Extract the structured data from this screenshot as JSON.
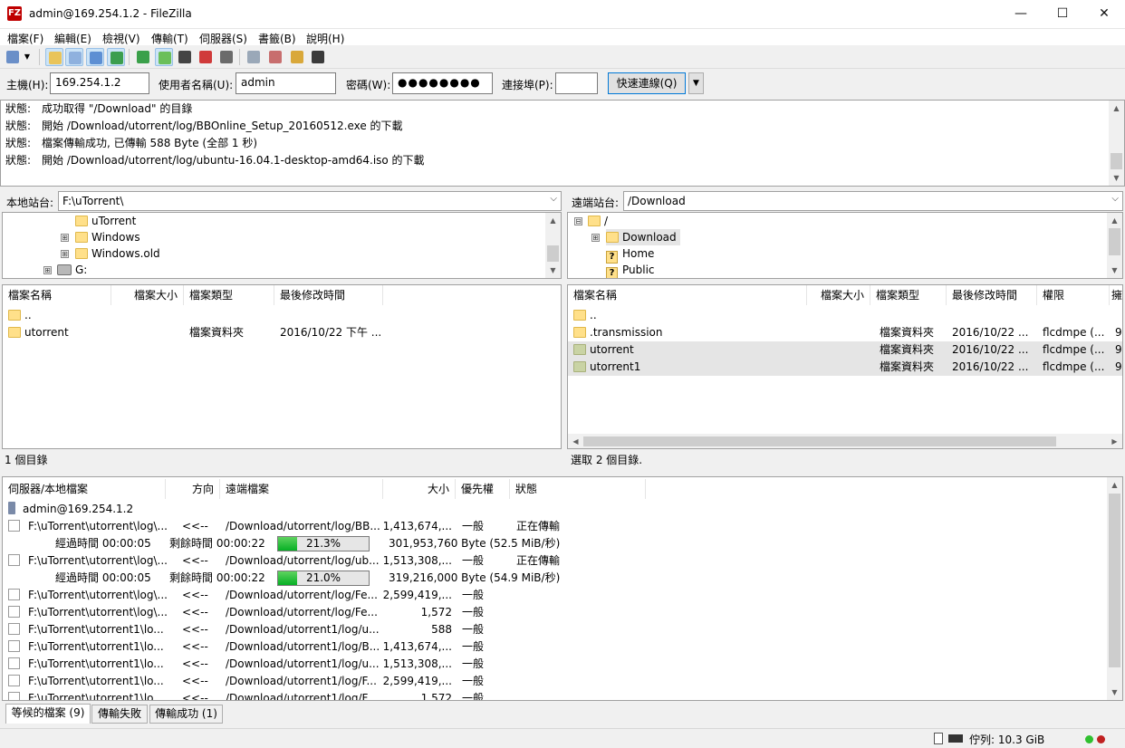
{
  "window": {
    "title": "admin@169.254.1.2 - FileZilla",
    "app_icon": "FZ",
    "minimize": "—",
    "maximize": "☐",
    "close": "✕"
  },
  "menu": [
    "檔案(F)",
    "編輯(E)",
    "檢視(V)",
    "傳輸(T)",
    "伺服器(S)",
    "書籤(B)",
    "說明(H)"
  ],
  "quickconnect": {
    "host_label": "主機(H):",
    "host_value": "169.254.1.2",
    "user_label": "使用者名稱(U):",
    "user_value": "admin",
    "pass_label": "密碼(W):",
    "pass_value": "●●●●●●●●",
    "port_label": "連接埠(P):",
    "port_value": "",
    "connect_label": "快速連線(Q)"
  },
  "log": [
    {
      "label": "狀態:",
      "text": "成功取得 \"/Download\" 的目錄"
    },
    {
      "label": "狀態:",
      "text": "開始 /Download/utorrent/log/BBOnline_Setup_20160512.exe 的下載"
    },
    {
      "label": "狀態:",
      "text": "檔案傳輸成功, 已傳輸 588 Byte (全部 1 秒)"
    },
    {
      "label": "狀態:",
      "text": "開始 /Download/utorrent/log/ubuntu-16.04.1-desktop-amd64.iso 的下載"
    }
  ],
  "local": {
    "site_label": "本地站台:",
    "path": "F:\\uTorrent\\",
    "tree": [
      "uTorrent",
      "Windows",
      "Windows.old",
      "G:"
    ],
    "columns": [
      "檔案名稱",
      "檔案大小",
      "檔案類型",
      "最後修改時間"
    ],
    "files": [
      {
        "name": "..",
        "size": "",
        "type": "",
        "modified": ""
      },
      {
        "name": "utorrent",
        "size": "",
        "type": "檔案資料夾",
        "modified": "2016/10/22 下午 ..."
      }
    ],
    "status": "1 個目錄"
  },
  "remote": {
    "site_label": "遠端站台:",
    "path": "/Download",
    "tree": [
      "/",
      "Download",
      "Home",
      "Public"
    ],
    "columns": [
      "檔案名稱",
      "檔案大小",
      "檔案類型",
      "最後修改時間",
      "權限",
      "擁"
    ],
    "files": [
      {
        "name": "..",
        "size": "",
        "type": "",
        "modified": "",
        "perm": "",
        "owner": ""
      },
      {
        "name": ".transmission",
        "size": "",
        "type": "檔案資料夾",
        "modified": "2016/10/22 ...",
        "perm": "flcdmpe (...",
        "owner": "9"
      },
      {
        "name": "utorrent",
        "size": "",
        "type": "檔案資料夾",
        "modified": "2016/10/22 ...",
        "perm": "flcdmpe (...",
        "owner": "9"
      },
      {
        "name": "utorrent1",
        "size": "",
        "type": "檔案資料夾",
        "modified": "2016/10/22 ...",
        "perm": "flcdmpe (...",
        "owner": "9"
      }
    ],
    "status": "選取 2 個目錄."
  },
  "queue": {
    "columns": [
      "伺服器/本地檔案",
      "方向",
      "遠端檔案",
      "大小",
      "優先權",
      "狀態"
    ],
    "server": "admin@169.254.1.2",
    "items": [
      {
        "local": "F:\\uTorrent\\utorrent\\log\\...",
        "dir": "<<--",
        "remote": "/Download/utorrent/log/BB...",
        "size": "1,413,674,...",
        "priority": "一般",
        "status": "正在傳輸",
        "progress": {
          "elapsed": "經過時間 00:00:05",
          "remaining": "剩餘時間 00:00:22",
          "percent": 0.213,
          "percent_label": "21.3%",
          "bytes": "301,953,760 Byte (52.5 MiB/秒)"
        }
      },
      {
        "local": "F:\\uTorrent\\utorrent\\log\\...",
        "dir": "<<--",
        "remote": "/Download/utorrent/log/ub...",
        "size": "1,513,308,...",
        "priority": "一般",
        "status": "正在傳輸",
        "progress": {
          "elapsed": "經過時間 00:00:05",
          "remaining": "剩餘時間 00:00:22",
          "percent": 0.21,
          "percent_label": "21.0%",
          "bytes": "319,216,000 Byte (54.9 MiB/秒)"
        }
      },
      {
        "local": "F:\\uTorrent\\utorrent\\log\\...",
        "dir": "<<--",
        "remote": "/Download/utorrent/log/Fe...",
        "size": "2,599,419,...",
        "priority": "一般",
        "status": ""
      },
      {
        "local": "F:\\uTorrent\\utorrent\\log\\...",
        "dir": "<<--",
        "remote": "/Download/utorrent/log/Fe...",
        "size": "1,572",
        "priority": "一般",
        "status": ""
      },
      {
        "local": "F:\\uTorrent\\utorrent1\\lo...",
        "dir": "<<--",
        "remote": "/Download/utorrent1/log/u...",
        "size": "588",
        "priority": "一般",
        "status": ""
      },
      {
        "local": "F:\\uTorrent\\utorrent1\\lo...",
        "dir": "<<--",
        "remote": "/Download/utorrent1/log/B...",
        "size": "1,413,674,...",
        "priority": "一般",
        "status": ""
      },
      {
        "local": "F:\\uTorrent\\utorrent1\\lo...",
        "dir": "<<--",
        "remote": "/Download/utorrent1/log/u...",
        "size": "1,513,308,...",
        "priority": "一般",
        "status": ""
      },
      {
        "local": "F:\\uTorrent\\utorrent1\\lo...",
        "dir": "<<--",
        "remote": "/Download/utorrent1/log/F...",
        "size": "2,599,419,...",
        "priority": "一般",
        "status": ""
      },
      {
        "local": "F:\\uTorrent\\utorrent1\\lo...",
        "dir": "<<--",
        "remote": "/Download/utorrent1/log/F...",
        "size": "1,572",
        "priority": "一般",
        "status": ""
      }
    ]
  },
  "tabs": [
    "等候的檔案 (9)",
    "傳輸失敗",
    "傳輸成功 (1)"
  ],
  "statusbar": {
    "queue": "佇列: 10.3 GiB",
    "colors": {
      "green": "#2fc02f",
      "red": "#c02020"
    }
  },
  "icons": {
    "tree_expand": "⊞",
    "tree_collapse": "⊟",
    "scroll_up": "▲",
    "scroll_down": "▼",
    "scroll_left": "◀",
    "scroll_right": "▶",
    "dropdown": "▼",
    "combo": "⌵"
  }
}
